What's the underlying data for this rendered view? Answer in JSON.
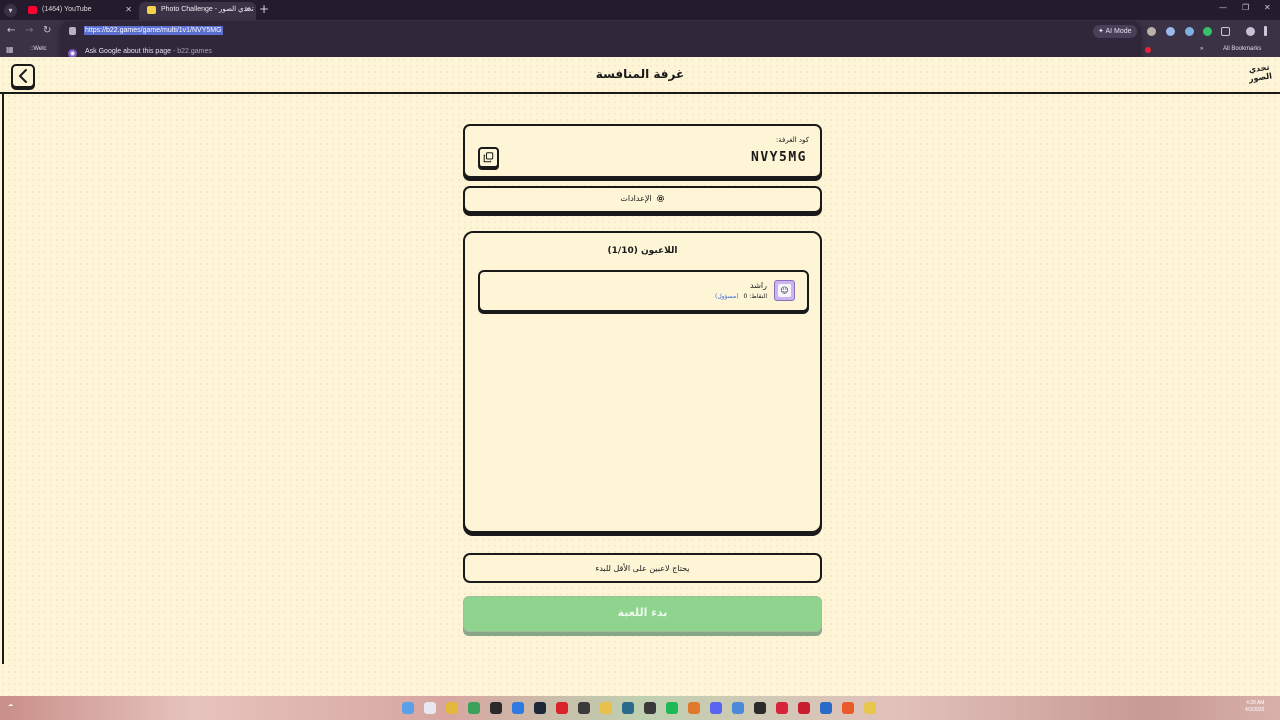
{
  "browser": {
    "tabs": [
      {
        "title": "(1464) YouTube",
        "active": false
      },
      {
        "title": "Photo Challenge - تحدي الصور",
        "active": true
      }
    ],
    "new_tab": "+",
    "url": "https://b22.games/game/multi/1v1/NVY5MG",
    "suggestion": {
      "text": "Ask Google about this page",
      "source": "b22.games"
    },
    "ai_mode_label": "AI Mode",
    "bookmark_item": "::Welc",
    "all_bookmarks": "All Bookmarks"
  },
  "header": {
    "title": "غرفة المنافسة",
    "logo_text": "تحدي الصور"
  },
  "room": {
    "code_label": "كود الغرفة:",
    "code": "NVY5MG"
  },
  "settings": {
    "label": "الإعدادات"
  },
  "players": {
    "title": "اللاعبون (1/10)",
    "list": [
      {
        "name": "راشد",
        "points": "النقاط: 0",
        "role": "(مسؤول)"
      }
    ]
  },
  "status": {
    "need_players": "يحتاج لاعبين على الأقل للبدء"
  },
  "actions": {
    "start_label": "بدء اللعبة"
  },
  "taskbar": {
    "clock_time": "4:28 AM",
    "clock_date": "4/3/2026"
  },
  "colors": {
    "page_bg": "#fdf5d6",
    "ink": "#1a1a1a",
    "start_button": "#8ed48f",
    "admin_badge": "#3b6bd8",
    "avatar": "#c9b6ea"
  }
}
